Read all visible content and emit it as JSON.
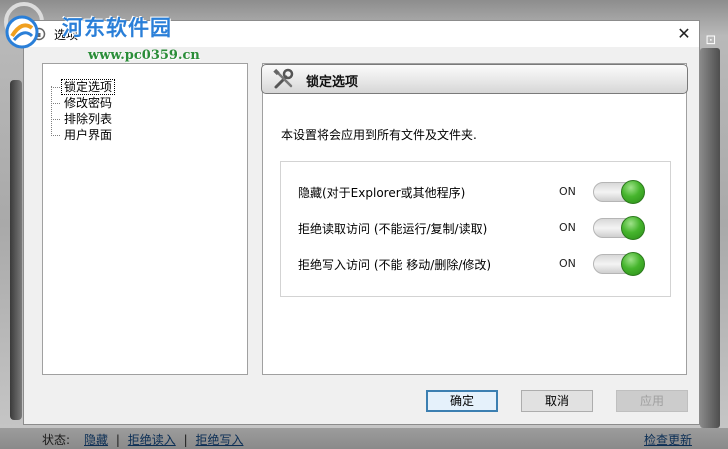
{
  "watermark": {
    "title": "河东软件园",
    "url": "www.pc0359.cn"
  },
  "dialog": {
    "title": "选项",
    "close_glyph": "✕"
  },
  "tree": {
    "items": [
      {
        "label": "锁定选项",
        "selected": true
      },
      {
        "label": "修改密码",
        "selected": false
      },
      {
        "label": "排除列表",
        "selected": false
      },
      {
        "label": "用户界面",
        "selected": false
      }
    ]
  },
  "content": {
    "header_title": "锁定选项",
    "header_icon": "tools-icon",
    "description": "本设置将会应用到所有文件及文件夹.",
    "options": [
      {
        "label": "隐藏(对于Explorer或其他程序)",
        "state": "ON"
      },
      {
        "label": "拒绝读取访问 (不能运行/复制/读取)",
        "state": "ON"
      },
      {
        "label": "拒绝写入访问 (不能 移动/删除/修改)",
        "state": "ON"
      }
    ],
    "toggle_color": "#46b52d"
  },
  "buttons": {
    "ok": "确定",
    "cancel": "取消",
    "apply": "应用"
  },
  "status_bar": {
    "label": "状态:",
    "links": [
      "隐藏",
      "拒绝读入",
      "拒绝写入"
    ],
    "separator": "|",
    "check_update": "检查更新"
  }
}
